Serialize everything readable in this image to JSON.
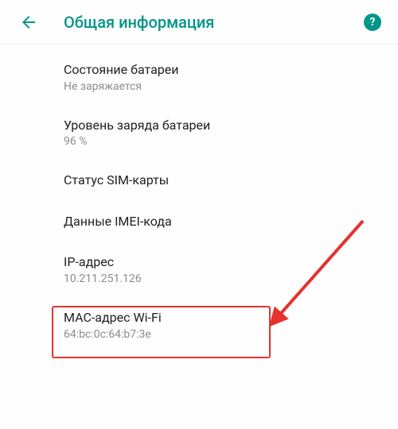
{
  "header": {
    "title": "Общая информация"
  },
  "items": [
    {
      "title": "Состояние батареи",
      "sub": "Не заряжается"
    },
    {
      "title": "Уровень заряда батареи",
      "sub": "96 %"
    },
    {
      "title": "Статус SIM-карты",
      "sub": ""
    },
    {
      "title": "Данные IMEI-кода",
      "sub": ""
    },
    {
      "title": "IP-адрес",
      "sub": "10.211.251.126"
    },
    {
      "title": "MAC-адрес Wi-Fi",
      "sub": "64:bc:0c:64:b7:3e"
    }
  ]
}
